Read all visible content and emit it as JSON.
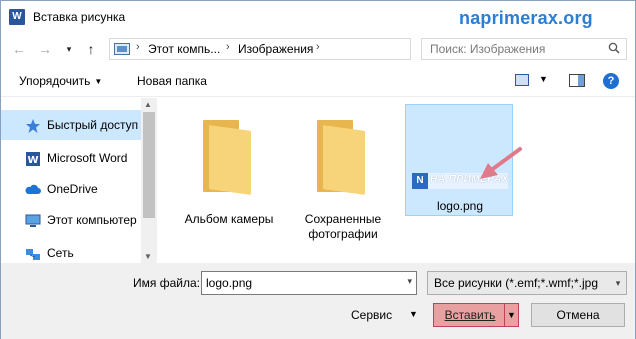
{
  "window": {
    "title": "Вставка рисунка",
    "app_icon": "word-icon",
    "watermark": "naprimerax.org"
  },
  "address": {
    "segments": [
      "Этот компь...",
      "Изображения"
    ],
    "separator": "›",
    "search_placeholder": "Поиск: Изображения"
  },
  "toolbar": {
    "organize_label": "Упорядочить",
    "new_folder_label": "Новая папка"
  },
  "sidebar": {
    "items": [
      {
        "label": "Быстрый доступ",
        "icon": "star-icon",
        "selected": true
      },
      {
        "label": "Microsoft Word",
        "icon": "word-icon",
        "selected": false
      },
      {
        "label": "OneDrive",
        "icon": "cloud-icon",
        "selected": false
      },
      {
        "label": "Этот компьютер",
        "icon": "computer-icon",
        "selected": false
      },
      {
        "label": "Сеть",
        "icon": "network-icon",
        "selected": false
      }
    ]
  },
  "files": [
    {
      "name": "Альбом камеры",
      "type": "folder",
      "selected": false
    },
    {
      "name_lines": [
        "Сохраненные",
        "фотографии"
      ],
      "type": "folder",
      "selected": false
    },
    {
      "name": "logo.png",
      "type": "image",
      "selected": true,
      "thumb_mark": "N",
      "thumb_text": "НА ПРИМЕРАХ"
    }
  ],
  "bottom": {
    "filename_label": "Имя файла:",
    "filename_value": "logo.png",
    "filter_value": "Все рисунки (*.emf;*.wmf;*.jpg",
    "tools_label": "Сервис",
    "insert_label": "Вставить",
    "cancel_label": "Отмена"
  },
  "colors": {
    "accent": "#2a7fd4",
    "selection": "#cce8ff",
    "arrow": "#e07a8a"
  }
}
